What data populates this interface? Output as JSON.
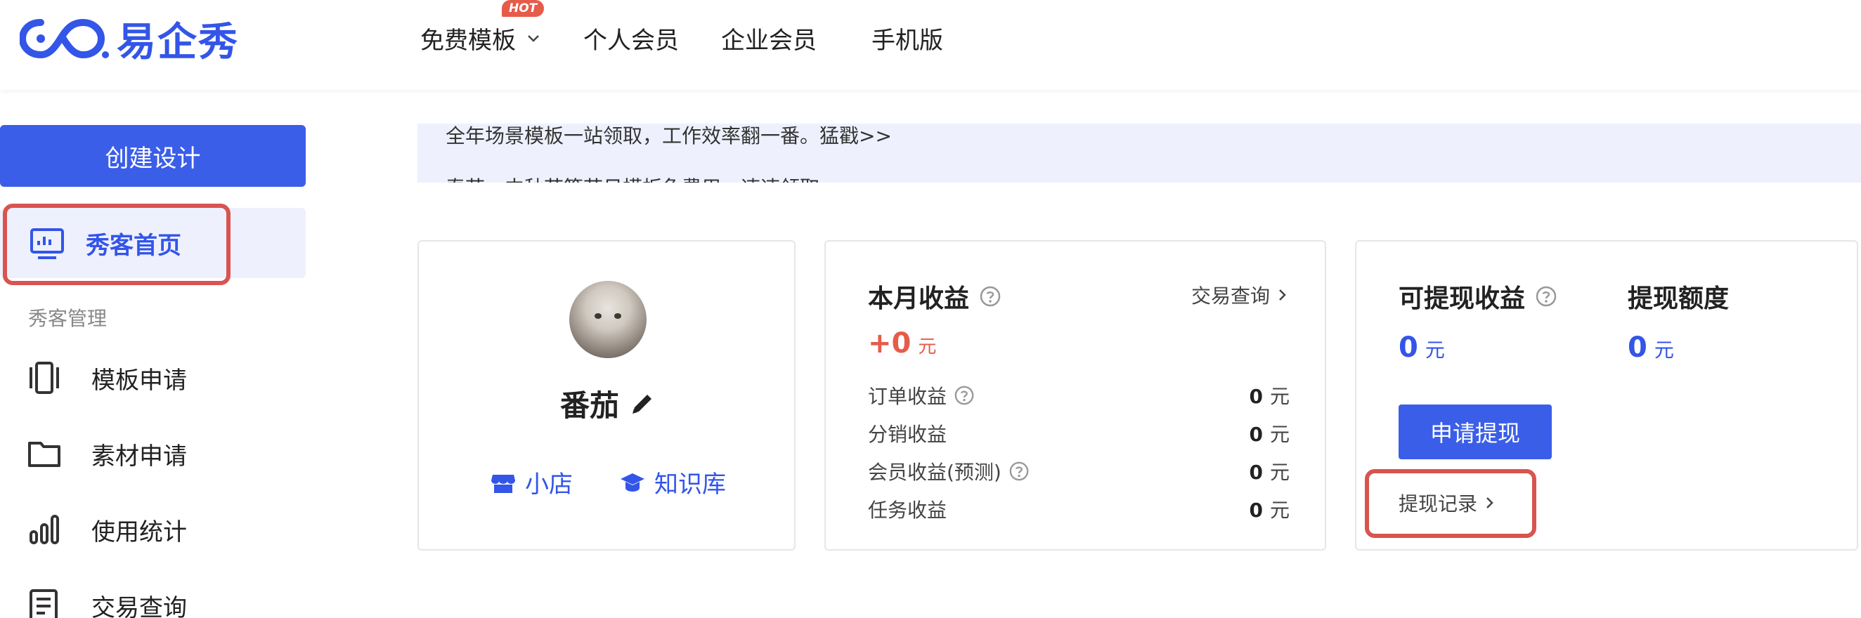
{
  "brand": {
    "name": "易企秀",
    "color": "#3355e8"
  },
  "nav": {
    "items": [
      {
        "label": "免费模板",
        "badge": "HOT",
        "has_dropdown": true
      },
      {
        "label": "个人会员"
      },
      {
        "label": "企业会员"
      },
      {
        "label": "手机版"
      }
    ]
  },
  "sidebar": {
    "create_button": "创建设计",
    "home": {
      "label": "秀客首页",
      "icon": "monitor-chart-icon",
      "active": true
    },
    "section_title": "秀客管理",
    "items": [
      {
        "label": "模板申请",
        "icon": "template-carousel-icon"
      },
      {
        "label": "素材申请",
        "icon": "folder-icon"
      },
      {
        "label": "使用统计",
        "icon": "bar-stats-icon"
      },
      {
        "label": "交易查询",
        "icon": "document-list-icon"
      }
    ]
  },
  "banner": {
    "line1": "全年场景模板一站领取，工作效率翻一番。猛戳>>",
    "line2": "春节、中秋节等节日模板免费用，速速领取>>"
  },
  "profile_card": {
    "username": "番茄",
    "links": [
      {
        "label": "小店",
        "icon": "shop-icon"
      },
      {
        "label": "知识库",
        "icon": "graduation-cap-icon"
      }
    ]
  },
  "monthly_card": {
    "title": "本月收益",
    "query_link": "交易查询",
    "value": "+0",
    "unit": "元",
    "rows": [
      {
        "label": "订单收益",
        "help": true,
        "value": "0",
        "unit": "元"
      },
      {
        "label": "分销收益",
        "help": false,
        "value": "0",
        "unit": "元"
      },
      {
        "label": "会员收益(预测)",
        "help": true,
        "value": "0",
        "unit": "元"
      },
      {
        "label": "任务收益",
        "help": false,
        "value": "0",
        "unit": "元"
      }
    ]
  },
  "withdraw_card": {
    "title": "可提现收益",
    "value": "0",
    "unit": "元",
    "limit_title": "提现额度",
    "limit_value": "0",
    "limit_unit": "元",
    "apply_button": "申请提现",
    "record_link": "提现记录"
  },
  "colors": {
    "accent": "#3b5ee9",
    "income_red": "#e65b4a",
    "highlight_outline": "#d9534f",
    "banner_bg": "#eef1fd"
  }
}
